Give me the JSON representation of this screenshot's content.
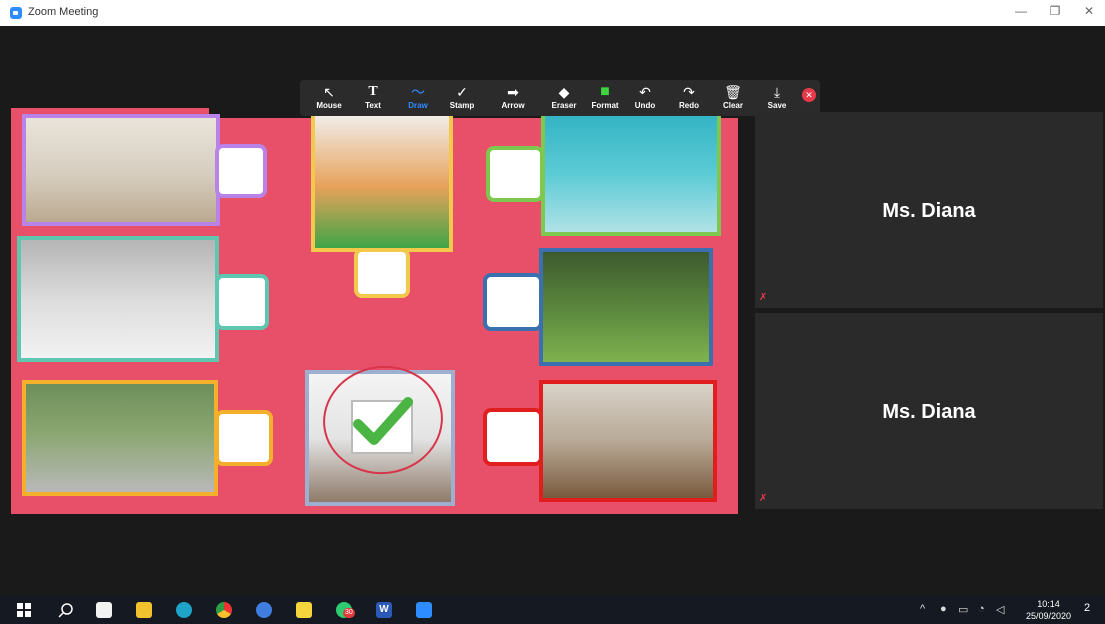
{
  "window": {
    "title": "Zoom Meeting",
    "minimize": "—",
    "restore": "❐",
    "close": "✕"
  },
  "toolbar": {
    "tools": [
      {
        "id": "mouse",
        "label": "Mouse",
        "icon": "↖"
      },
      {
        "id": "text",
        "label": "Text",
        "icon": "T"
      },
      {
        "id": "draw",
        "label": "Draw",
        "icon": "〜",
        "active": true
      },
      {
        "id": "stamp",
        "label": "Stamp",
        "icon": "✓"
      },
      {
        "id": "arrow",
        "label": "Arrow",
        "icon": "➡"
      },
      {
        "id": "eraser",
        "label": "Eraser",
        "icon": "◆"
      },
      {
        "id": "format",
        "label": "Format",
        "icon": "■"
      },
      {
        "id": "undo",
        "label": "Undo",
        "icon": "↶"
      },
      {
        "id": "redo",
        "label": "Redo",
        "icon": "↷"
      },
      {
        "id": "clear",
        "label": "Clear",
        "icon": "🗑"
      },
      {
        "id": "save",
        "label": "Save",
        "icon": "⤓"
      }
    ],
    "close_icon": "✕"
  },
  "participants": [
    {
      "name": "Ms. Diana"
    },
    {
      "name": "Ms. Diana"
    }
  ],
  "taskbar": {
    "time": "10:14",
    "date": "25/09/2020",
    "notifications": "2",
    "whatsapp_badge": "30",
    "word_label": "W"
  },
  "colors": {
    "share_bg": "#e8506a",
    "accent": "#2d8cff",
    "check": "#4bb543"
  }
}
